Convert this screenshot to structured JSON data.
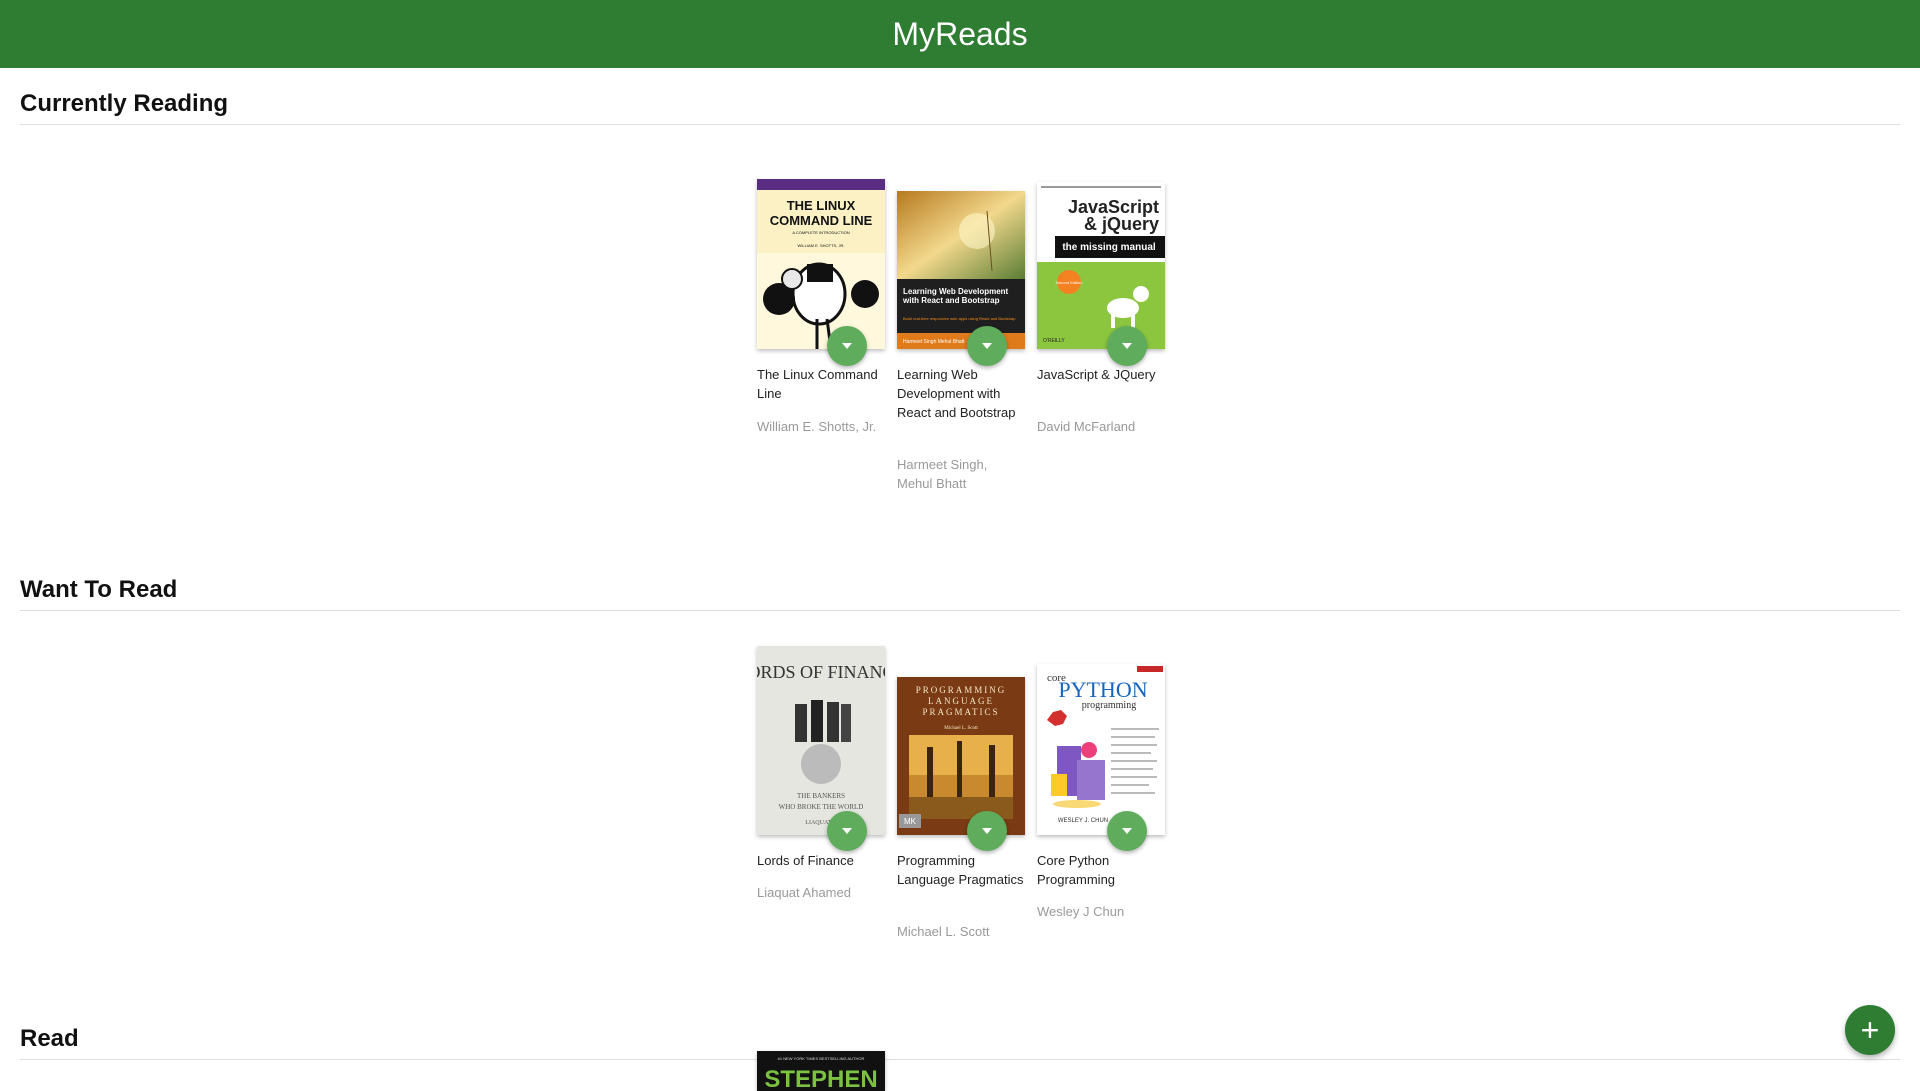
{
  "header": {
    "title": "MyReads"
  },
  "shelves": [
    {
      "title": "Currently Reading",
      "books": [
        {
          "title": "The Linux Command Line",
          "authors": "William E. Shotts, Jr."
        },
        {
          "title": "Learning Web Development with React and Bootstrap",
          "authors": "Harmeet Singh, Mehul Bhatt"
        },
        {
          "title": "JavaScript & JQuery",
          "authors": "David McFarland"
        }
      ]
    },
    {
      "title": "Want To Read",
      "books": [
        {
          "title": "Lords of Finance",
          "authors": "Liaquat Ahamed"
        },
        {
          "title": "Programming Language Pragmatics",
          "authors": "Michael L. Scott"
        },
        {
          "title": "Core Python Programming",
          "authors": "Wesley J Chun"
        }
      ]
    },
    {
      "title": "Read",
      "books": [
        {
          "cover_text": "STEPHEN"
        }
      ]
    }
  ],
  "covers": {
    "linux": {
      "line1": "THE LINUX",
      "line2": "COMMAND LINE",
      "sub": "A COMPLETE INTRODUCTION",
      "author": "WILLIAM E. SHOTTS, JR."
    },
    "react": {
      "title": "Learning Web Development with React and Bootstrap",
      "sub": "Build real-time responsive web apps using React and Bootstrap",
      "authors": "Harmeet Singh  Mehul Bhatt"
    },
    "jquery": {
      "line1": "JavaScript",
      "line2": "& jQuery",
      "banner": "the missing manual",
      "badge": "Second Edition",
      "pub": "O'REILLY"
    },
    "finance": {
      "line1": "LORDS OF FINANCE",
      "sub1": "THE BANKERS",
      "sub2": "WHO BROKE THE WORLD",
      "author": "LIAQUAT A"
    },
    "pragmatics": {
      "line1": "PROGRAMMING",
      "line2": "LANGUAGE",
      "line3": "PRAGMATICS",
      "author": "Michael L. Scott",
      "pub": "MK"
    },
    "python": {
      "line1": "core",
      "line2": "PYTHON",
      "line3": "programming",
      "author": "WESLEY J. CHUN"
    },
    "stephen": {
      "top": "#1 NEW YORK TIMES BESTSELLING AUTHOR"
    }
  },
  "colors": {
    "header": "#2e7d32",
    "changer": "#60ac5d",
    "fab": "#2e7d32"
  },
  "fab": {
    "icon": "plus-icon",
    "label": "+"
  }
}
